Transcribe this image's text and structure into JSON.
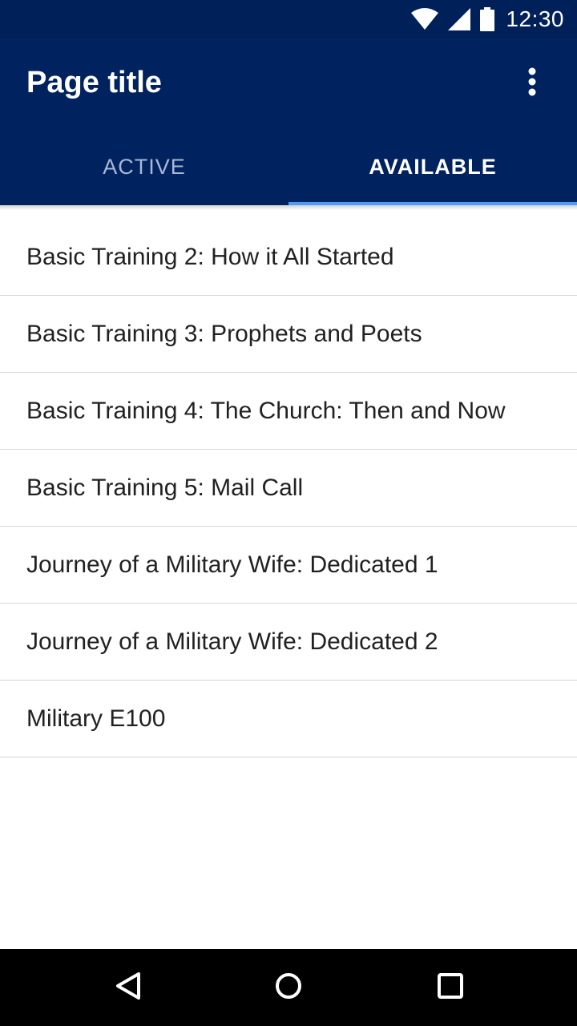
{
  "status_bar": {
    "time": "12:30",
    "icons": [
      "wifi-icon",
      "cell-signal-icon",
      "battery-icon"
    ]
  },
  "app_bar": {
    "title": "Page title",
    "overflow_icon": "more-vert-icon"
  },
  "tabs": [
    {
      "label": "ACTIVE",
      "selected": false
    },
    {
      "label": "AVAILABLE",
      "selected": true
    }
  ],
  "list": {
    "items": [
      {
        "label": "Basic Training 2: How it All Started"
      },
      {
        "label": "Basic Training 3: Prophets and Poets"
      },
      {
        "label": "Basic Training 4: The Church: Then and Now"
      },
      {
        "label": "Basic Training 5: Mail Call"
      },
      {
        "label": "Journey of a Military Wife: Dedicated 1"
      },
      {
        "label": "Journey of a Military Wife: Dedicated 2"
      },
      {
        "label": "Military E100"
      }
    ]
  },
  "nav_bar": {
    "buttons": [
      "back-icon",
      "home-icon",
      "recents-icon"
    ]
  },
  "colors": {
    "status_bar": "#00205a",
    "app_bar": "#00235f",
    "tab_indicator": "#4f9cf5",
    "divider": "#d6d6d6"
  }
}
